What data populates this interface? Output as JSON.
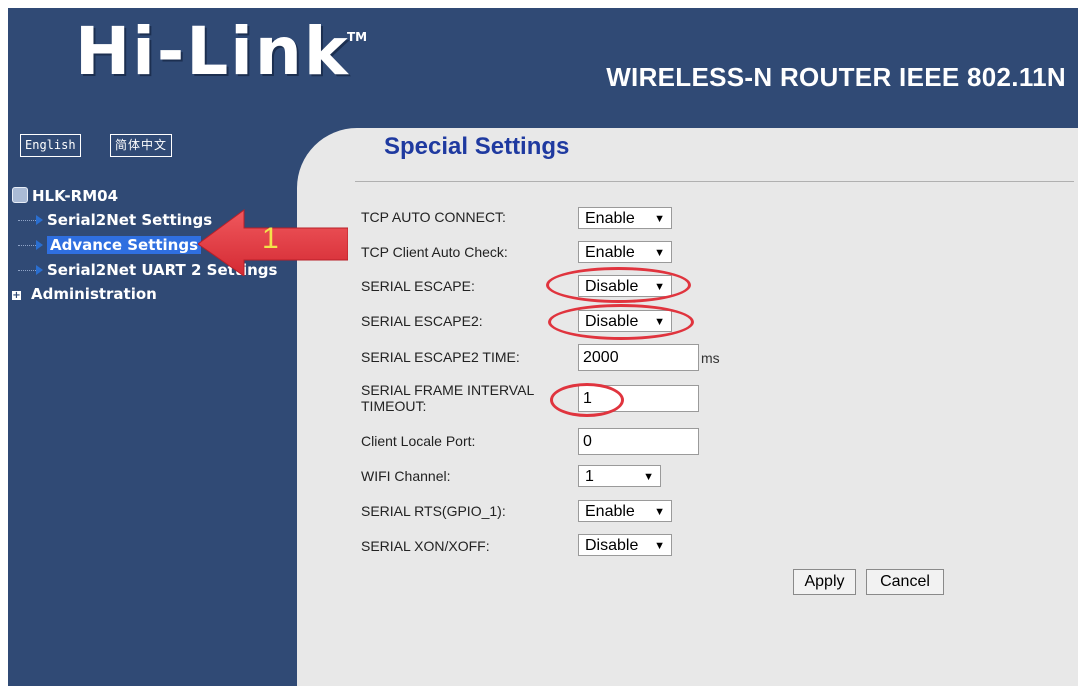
{
  "header": {
    "logo_text": "Hi-Link",
    "trademark": "TM",
    "subtitle": "WIRELESS-N ROUTER IEEE 802.11N"
  },
  "language": {
    "english_label": "English",
    "chinese_label": "简体中文"
  },
  "nav": {
    "root_label": "HLK-RM04",
    "items": [
      {
        "label": "Serial2Net Settings"
      },
      {
        "label": "Advance Settings"
      },
      {
        "label": "Serial2Net UART 2 Settings"
      }
    ],
    "admin_label": "Administration"
  },
  "annotation": {
    "number": "1",
    "color": "#e0343e"
  },
  "page": {
    "title": "Special Settings",
    "rows": [
      {
        "label": "TCP AUTO CONNECT:",
        "value": "Enable"
      },
      {
        "label": "TCP Client Auto Check:",
        "value": "Enable"
      },
      {
        "label": "SERIAL ESCAPE:",
        "value": "Disable"
      },
      {
        "label": "SERIAL ESCAPE2:",
        "value": "Disable"
      },
      {
        "label": "SERIAL ESCAPE2 TIME:",
        "value": "2000",
        "unit": "ms"
      },
      {
        "label": "SERIAL FRAME INTERVAL TIMEOUT:",
        "value": "1"
      },
      {
        "label": "Client Locale Port:",
        "value": "0"
      },
      {
        "label": "WIFI Channel:",
        "value": "1"
      },
      {
        "label": "SERIAL RTS(GPIO_1):",
        "value": "Enable"
      },
      {
        "label": "SERIAL XON/XOFF:",
        "value": "Disable"
      }
    ],
    "apply_label": "Apply",
    "cancel_label": "Cancel"
  },
  "colors": {
    "sidebar_bg": "#304a75",
    "content_bg": "#e8e8e8",
    "title_color": "#1f3aa0",
    "selected_item": "#2f6fe0",
    "highlight_circle": "#e0343e"
  }
}
